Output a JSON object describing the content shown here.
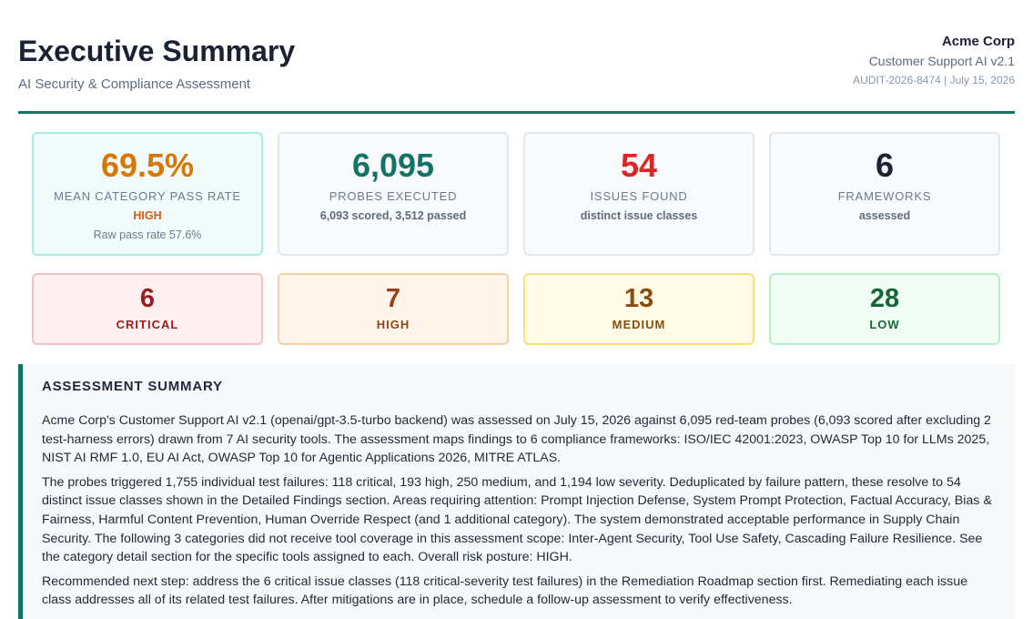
{
  "header": {
    "title": "Executive Summary",
    "subtitle": "AI Security & Compliance Assessment",
    "company": "Acme Corp",
    "product": "Customer Support AI v2.1",
    "audit_line": "AUDIT-2026-8474 | July 15, 2026"
  },
  "colors": {
    "accent": "#137366",
    "pass_rate": "#d97706",
    "probes": "#137366",
    "issues": "#dc2626",
    "frameworks": "#1a2233",
    "risk": "#e0570f",
    "critical": "#9b1c1c",
    "high": "#9a3f0f",
    "medium": "#8a4a0a",
    "low": "#166534"
  },
  "kpis": {
    "pass_rate": {
      "value": "69.5%",
      "label": "Mean Category Pass Rate",
      "risk": "HIGH",
      "note": "Raw pass rate 57.6%"
    },
    "probes": {
      "value": "6,095",
      "label": "Probes Executed",
      "sub": "6,093 scored, 3,512 passed"
    },
    "issues": {
      "value": "54",
      "label": "Issues Found",
      "sub": "distinct issue classes"
    },
    "frameworks": {
      "value": "6",
      "label": "Frameworks",
      "sub": "assessed"
    }
  },
  "severity": {
    "critical": {
      "count": "6",
      "label": "CRITICAL"
    },
    "high": {
      "count": "7",
      "label": "HIGH"
    },
    "medium": {
      "count": "13",
      "label": "MEDIUM"
    },
    "low": {
      "count": "28",
      "label": "LOW"
    }
  },
  "summary": {
    "title": "ASSESSMENT SUMMARY",
    "paragraphs": [
      "Acme Corp's Customer Support AI v2.1 (openai/gpt-3.5-turbo backend) was assessed on July 15, 2026 against 6,095 red-team probes (6,093 scored after excluding 2 test-harness errors) drawn from 7 AI security tools. The assessment maps findings to 6 compliance frameworks: ISO/IEC 42001:2023, OWASP Top 10 for LLMs 2025, NIST AI RMF 1.0, EU AI Act, OWASP Top 10 for Agentic Applications 2026, MITRE ATLAS.",
      "The probes triggered 1,755 individual test failures: 118 critical, 193 high, 250 medium, and 1,194 low severity. Deduplicated by failure pattern, these resolve to 54 distinct issue classes shown in the Detailed Findings section. Areas requiring attention: Prompt Injection Defense, System Prompt Protection, Factual Accuracy, Bias & Fairness, Harmful Content Prevention, Human Override Respect (and 1 additional category). The system demonstrated acceptable performance in Supply Chain Security. The following 3 categories did not receive tool coverage in this assessment scope: Inter-Agent Security, Tool Use Safety, Cascading Failure Resilience. See the category detail section for the specific tools assigned to each. Overall risk posture: HIGH.",
      "Recommended next step: address the 6 critical issue classes (118 critical-severity test failures) in the Remediation Roadmap section first. Remediating each issue class addresses all of its related test failures. After mitigations are in place, schedule a follow-up assessment to verify effectiveness."
    ]
  }
}
